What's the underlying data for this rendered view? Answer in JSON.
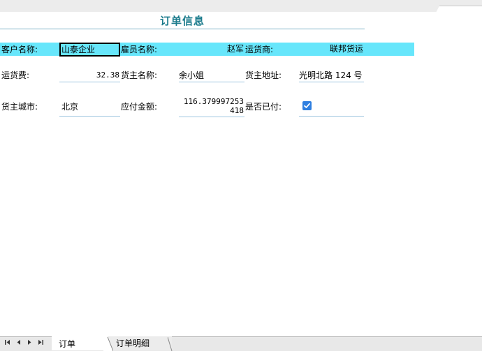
{
  "form": {
    "title": "订单信息"
  },
  "fields": {
    "customer_label": "客户名称:",
    "customer_value": "山泰企业",
    "employee_label": "雇员名称:",
    "employee_value": "赵军",
    "shipper_label": "运货商:",
    "shipper_value": "联邦货运",
    "freight_label": "运货费:",
    "freight_value": "32.38",
    "ship_name_label": "货主名称:",
    "ship_name_value": "余小姐",
    "ship_address_label": "货主地址:",
    "ship_address_value": "光明北路 124 号",
    "ship_city_label": "货主城市:",
    "ship_city_value": "北京",
    "amount_label": "应付金额:",
    "amount_value": "116.379997253418",
    "paid_label": "是否已付:",
    "paid_checked": true
  },
  "tabs": [
    {
      "label": "订单"
    },
    {
      "label": "订单明细"
    }
  ],
  "nav": {
    "first": "first-record-icon",
    "prev": "previous-record-icon",
    "next": "next-record-icon",
    "last": "last-record-icon"
  },
  "colors": {
    "title": "#1b7b8c",
    "highlight_row": "#67e6fb",
    "checkbox": "#2f7fe0",
    "field_underline": "#9ec6e0"
  }
}
